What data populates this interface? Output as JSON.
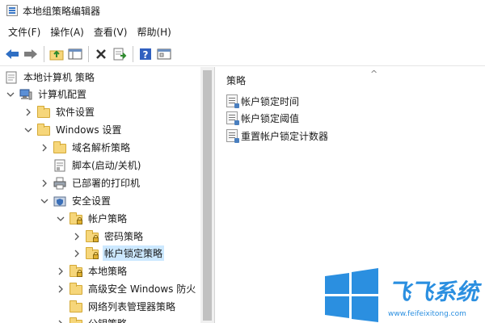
{
  "window": {
    "title": "本地组策略编辑器"
  },
  "menu": [
    {
      "label": "文件(F)"
    },
    {
      "label": "操作(A)"
    },
    {
      "label": "查看(V)"
    },
    {
      "label": "帮助(H)"
    }
  ],
  "toolbar": {
    "icons": [
      "back-arrow-icon",
      "forward-arrow-icon",
      "up-folder-icon",
      "show-hide-tree-icon",
      "delete-icon",
      "export-list-icon",
      "help-icon",
      "properties-icon"
    ]
  },
  "tree": {
    "items": [
      {
        "label": "本地计算机 策略",
        "icon": "policy-doc-icon",
        "expander": ""
      },
      {
        "label": "计算机配置",
        "icon": "computer-icon",
        "expander": "expanded"
      },
      {
        "label": "软件设置",
        "icon": "folder-icon",
        "expander": "collapsed"
      },
      {
        "label": "Windows 设置",
        "icon": "folder-icon",
        "expander": "expanded"
      },
      {
        "label": "域名解析策略",
        "icon": "folder-icon",
        "expander": "collapsed"
      },
      {
        "label": "脚本(启动/关机)",
        "icon": "script-icon",
        "expander": ""
      },
      {
        "label": "已部署的打印机",
        "icon": "printer-icon",
        "expander": "collapsed"
      },
      {
        "label": "安全设置",
        "icon": "security-icon",
        "expander": "expanded"
      },
      {
        "label": "帐户策略",
        "icon": "locked-folder-icon",
        "expander": "expanded"
      },
      {
        "label": "密码策略",
        "icon": "locked-folder-icon",
        "expander": "collapsed"
      },
      {
        "label": "帐户锁定策略",
        "icon": "locked-folder-icon",
        "expander": "collapsed",
        "selected": true
      },
      {
        "label": "本地策略",
        "icon": "locked-folder-icon",
        "expander": "collapsed"
      },
      {
        "label": "高级安全 Windows 防火",
        "icon": "folder-icon",
        "expander": "collapsed"
      },
      {
        "label": "网络列表管理器策略",
        "icon": "folder-icon",
        "expander": ""
      },
      {
        "label": "公钥策略",
        "icon": "folder-icon",
        "expander": "collapsed"
      }
    ]
  },
  "details": {
    "column_header": "策略",
    "sort_indicator": "^",
    "policies": [
      {
        "label": "帐户锁定时间"
      },
      {
        "label": "帐户锁定阈值"
      },
      {
        "label": "重置帐户锁定计数器"
      }
    ]
  },
  "watermark": {
    "brand_text": "飞飞系统",
    "url_text": "www.feifeixitong.com",
    "colors": {
      "logo": "#2b8fe0",
      "text": "#2b8fe0"
    }
  },
  "colors": {
    "selection": "#cce8ff",
    "folder": "#f6d67a",
    "accent": "#3a78c8"
  }
}
